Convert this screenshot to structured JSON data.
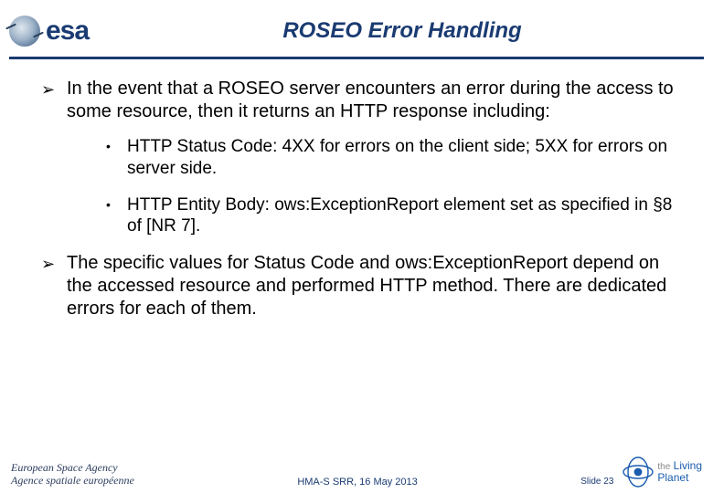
{
  "header": {
    "logo_text": "esa",
    "title": "ROSEO Error Handling"
  },
  "bullets": {
    "main1": "In the event that a ROSEO server encounters an error during the access to some resource, then it returns an HTTP response including:",
    "sub1": "HTTP Status Code: 4XX for errors on the client side; 5XX for errors on server side.",
    "sub2": "HTTP Entity Body: ows:ExceptionReport element set as specified in §8 of [NR 7].",
    "main2": "The specific values for Status Code and ows:ExceptionReport depend on the accessed resource and performed HTTP method. There are dedicated errors for each of them."
  },
  "footer": {
    "agency_line1": "European Space Agency",
    "agency_line2": "Agence spatiale européenne",
    "center": "HMA-S SRR, 16 May 2013",
    "slide": "Slide 23",
    "living_planet_the": "the",
    "living_planet_line1": "Living",
    "living_planet_line2": "Planet"
  }
}
